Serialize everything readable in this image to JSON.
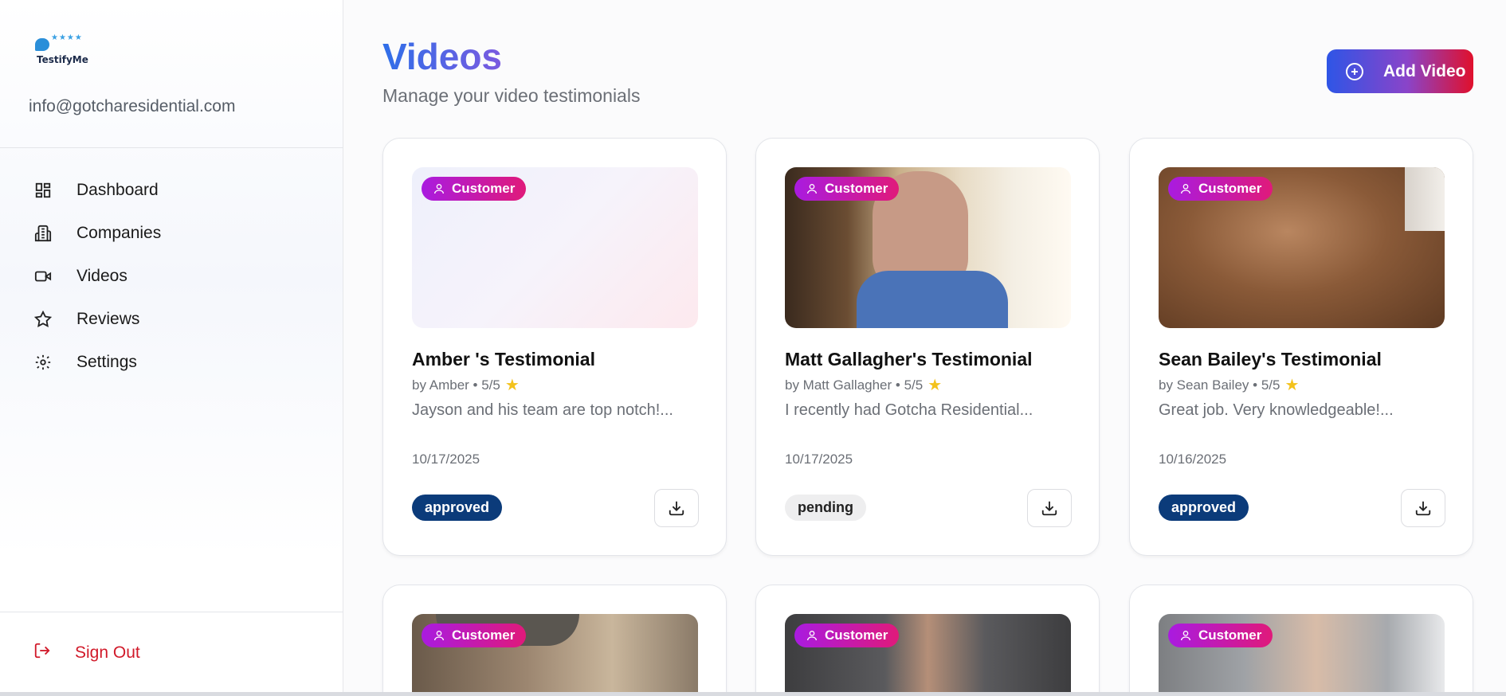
{
  "sidebar": {
    "brand_name": "TestifyMe",
    "email": "info@gotcharesidential.com",
    "items": [
      {
        "label": "Dashboard",
        "icon": "dashboard-icon"
      },
      {
        "label": "Companies",
        "icon": "building-icon"
      },
      {
        "label": "Videos",
        "icon": "video-icon"
      },
      {
        "label": "Reviews",
        "icon": "star-icon"
      },
      {
        "label": "Settings",
        "icon": "gear-icon"
      }
    ],
    "sign_out": "Sign Out"
  },
  "header": {
    "title": "Videos",
    "subtitle": "Manage your video testimonials",
    "add_button": "Add Video"
  },
  "cards": [
    {
      "badge": "Customer",
      "title": "Amber 's Testimonial",
      "author": "by Amber",
      "rating": "5/5",
      "excerpt": "Jayson and his team are top notch!...",
      "date": "10/17/2025",
      "status": "approved"
    },
    {
      "badge": "Customer",
      "title": "Matt Gallagher's Testimonial",
      "author": "by Matt Gallagher",
      "rating": "5/5",
      "excerpt": "I recently had Gotcha Residential...",
      "date": "10/17/2025",
      "status": "pending"
    },
    {
      "badge": "Customer",
      "title": "Sean Bailey's Testimonial",
      "author": "by Sean Bailey",
      "rating": "5/5",
      "excerpt": "Great job. Very knowledgeable!...",
      "date": "10/16/2025",
      "status": "approved"
    }
  ],
  "bottom_cards": [
    {
      "badge": "Customer"
    },
    {
      "badge": "Customer"
    },
    {
      "badge": "Customer"
    }
  ],
  "colors": {
    "accent_blue": "#2f6fe8",
    "approved": "#0b3b7a",
    "sign_out": "#d11a2a",
    "badge_gradient_start": "#a91be0",
    "badge_gradient_end": "#e01a7a"
  }
}
